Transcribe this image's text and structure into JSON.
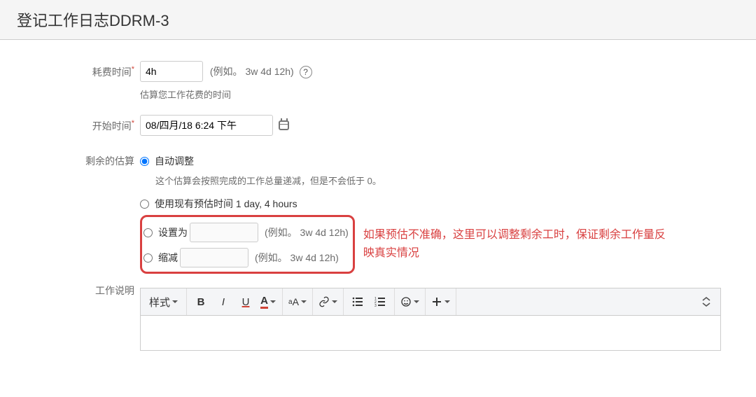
{
  "title": "登记工作日志DDRM-3",
  "timeSpent": {
    "label": "耗费时间",
    "value": "4h",
    "example": "(例如。 3w 4d 12h)",
    "hint": "估算您工作花费的时间"
  },
  "dateStarted": {
    "label": "开始时间",
    "value": "08/四月/18 6:24 下午"
  },
  "remaining": {
    "label": "剩余的估算",
    "auto": {
      "label": "自动调整",
      "checked": true,
      "hint": "这个估算会按照完成的工作总量递减，但是不会低于 0。"
    },
    "useExisting": {
      "label": "使用现有预估时间 1 day, 4 hours",
      "checked": false
    },
    "setTo": {
      "label": "设置为",
      "checked": false,
      "example": "(例如。 3w 4d 12h)"
    },
    "reduceBy": {
      "label": "缩减",
      "checked": false,
      "example": "(例如。 3w 4d 12h)"
    }
  },
  "annotation": "如果预估不准确，这里可以调整剩余工时，保证剩余工作量反映真实情况",
  "workDesc": {
    "label": "工作说明"
  },
  "toolbar": {
    "style": "样式"
  }
}
